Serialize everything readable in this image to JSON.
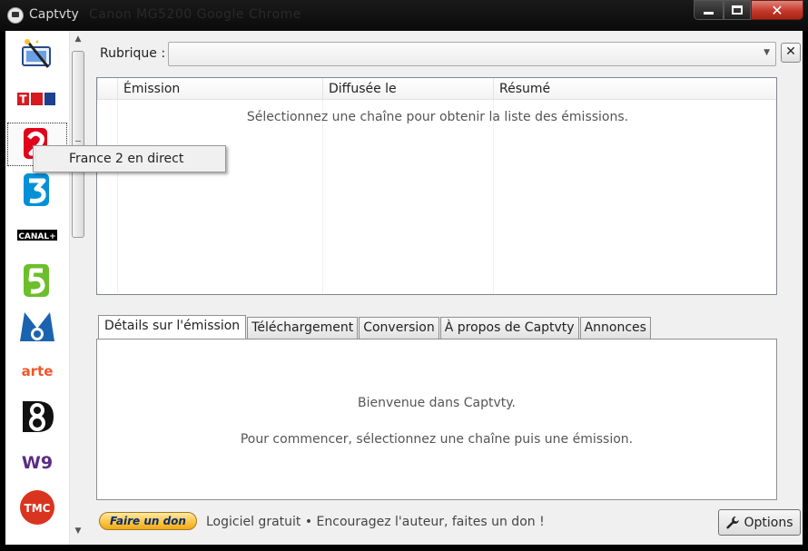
{
  "window": {
    "title": "Captvty",
    "background_text": "Canon MG5200   Google Chrome"
  },
  "channels": [
    {
      "id": "tv-magic",
      "label": ""
    },
    {
      "id": "tf1",
      "label": "TF1"
    },
    {
      "id": "france2",
      "label": "2"
    },
    {
      "id": "france3",
      "label": "3"
    },
    {
      "id": "canalplus",
      "label": "CANAL+"
    },
    {
      "id": "france5",
      "label": "5"
    },
    {
      "id": "m6",
      "label": "M6"
    },
    {
      "id": "arte",
      "label": "arte"
    },
    {
      "id": "d8",
      "label": "D8"
    },
    {
      "id": "w9",
      "label": "W9"
    },
    {
      "id": "tmc",
      "label": "TMC"
    }
  ],
  "rubrique": {
    "label": "Rubrique :",
    "value": ""
  },
  "clear_button": "✕",
  "emissions_table": {
    "columns": [
      "Émission",
      "Diffusée le",
      "Résumé"
    ],
    "empty_message": "Sélectionnez une chaîne pour obtenir la liste des émissions."
  },
  "context_menu": {
    "items": [
      "France 2 en direct"
    ]
  },
  "tabs": [
    {
      "label": "Détails sur l'émission",
      "active": true
    },
    {
      "label": "Téléchargement",
      "active": false
    },
    {
      "label": "Conversion",
      "active": false
    },
    {
      "label": "À propos de Captvty",
      "active": false
    },
    {
      "label": "Annonces",
      "active": false
    }
  ],
  "details_panel": {
    "welcome": "Bienvenue dans Captvty.",
    "instructions": "Pour commencer, sélectionnez une chaîne puis une émission."
  },
  "footer": {
    "donate_label": "Faire un don",
    "text": "Logiciel gratuit  •  Encouragez l'auteur, faites un don !",
    "options_label": "Options"
  },
  "colors": {
    "tf1_red": "#d71920",
    "tf1_blue": "#1f3f8f",
    "france2_red": "#e2001a",
    "france3_blue": "#0091d6",
    "france5_green": "#6cbf2a",
    "m6_blue": "#1a63b0",
    "arte_orange": "#f0572a",
    "w9_purple": "#5b2c83",
    "tmc_red": "#d9341f"
  },
  "icons": {
    "options": "wrench-icon",
    "clear": "close-icon",
    "combo": "chevron-down-icon"
  }
}
